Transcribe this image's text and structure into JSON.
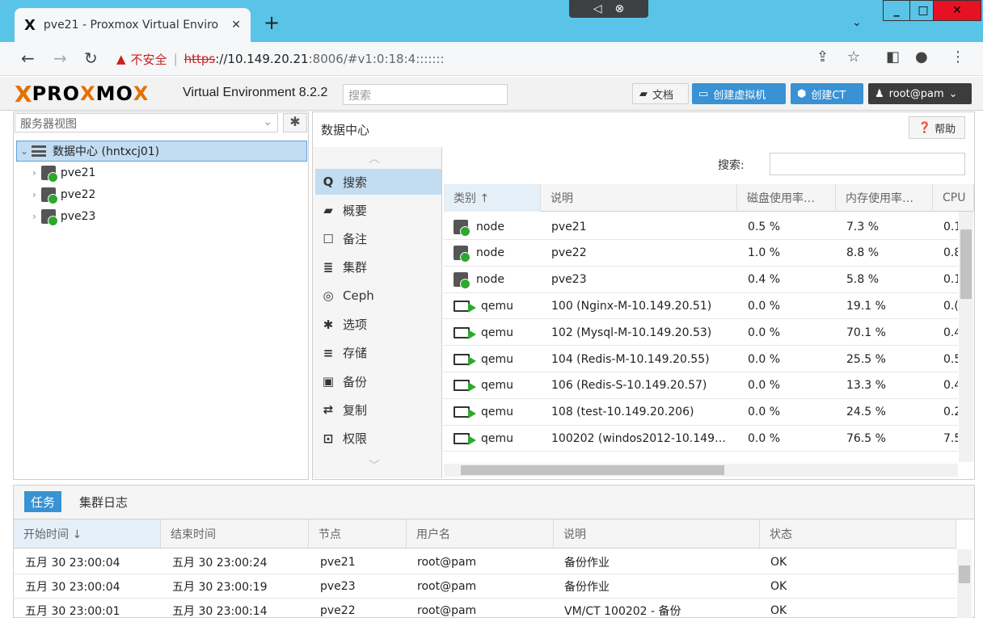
{
  "browser": {
    "tab_title": "pve21 - Proxmox Virtual Enviro",
    "tab_favicon": "X",
    "new_tab": "+",
    "url_warning": "不安全",
    "url_proto": "https",
    "url_host": "://10.149.20.21",
    "url_rest": ":8006/#v1:0:18:4:::::::"
  },
  "header": {
    "logo_x": "X",
    "logo_text_1": "PRO",
    "logo_text_x": "X",
    "logo_text_2": "MO",
    "logo_text_x2": "X",
    "app_name": "Virtual Environment 8.2.2",
    "search_placeholder": "搜索",
    "docs_label": "文档",
    "create_vm_label": "创建虚拟机",
    "create_ct_label": "创建CT",
    "user_label": "root@pam"
  },
  "tree": {
    "view_label": "服务器视图",
    "datacenter_label": "数据中心 (hntxcj01)",
    "nodes": [
      "pve21",
      "pve22",
      "pve23"
    ]
  },
  "center": {
    "title": "数据中心",
    "help_label": "帮助",
    "search_label": "搜索:",
    "menu": [
      {
        "icon": "search-icon",
        "glyph": "Q",
        "label": "搜索"
      },
      {
        "icon": "book-icon",
        "glyph": "▰",
        "label": "概要"
      },
      {
        "icon": "note-icon",
        "glyph": "☐",
        "label": "备注"
      },
      {
        "icon": "cluster-icon",
        "glyph": "≣",
        "label": "集群"
      },
      {
        "icon": "ceph-icon",
        "glyph": "◎",
        "label": "Ceph"
      },
      {
        "icon": "gear-icon",
        "glyph": "✱",
        "label": "选项"
      },
      {
        "icon": "storage-icon",
        "glyph": "≡",
        "label": "存储"
      },
      {
        "icon": "backup-icon",
        "glyph": "▣",
        "label": "备份"
      },
      {
        "icon": "replication-icon",
        "glyph": "⇄",
        "label": "复制"
      },
      {
        "icon": "unlock-icon",
        "glyph": "⊡",
        "label": "权限"
      }
    ],
    "columns": [
      "类别 ↑",
      "说明",
      "磁盘使用率…",
      "内存使用率…",
      "CPU"
    ],
    "rows": [
      {
        "type": "node",
        "desc": "pve21",
        "disk": "0.5 %",
        "mem": "7.3 %",
        "cpu": "0.1"
      },
      {
        "type": "node",
        "desc": "pve22",
        "disk": "1.0 %",
        "mem": "8.8 %",
        "cpu": "0.8"
      },
      {
        "type": "node",
        "desc": "pve23",
        "disk": "0.4 %",
        "mem": "5.8 %",
        "cpu": "0.1"
      },
      {
        "type": "qemu",
        "desc": "100 (Nginx-M-10.149.20.51)",
        "disk": "0.0 %",
        "mem": "19.1 %",
        "cpu": "0.("
      },
      {
        "type": "qemu",
        "desc": "102 (Mysql-M-10.149.20.53)",
        "disk": "0.0 %",
        "mem": "70.1 %",
        "cpu": "0.4"
      },
      {
        "type": "qemu",
        "desc": "104 (Redis-M-10.149.20.55)",
        "disk": "0.0 %",
        "mem": "25.5 %",
        "cpu": "0.5"
      },
      {
        "type": "qemu",
        "desc": "106 (Redis-S-10.149.20.57)",
        "disk": "0.0 %",
        "mem": "13.3 %",
        "cpu": "0.4"
      },
      {
        "type": "qemu",
        "desc": "108 (test-10.149.20.206)",
        "disk": "0.0 %",
        "mem": "24.5 %",
        "cpu": "0.2"
      },
      {
        "type": "qemu",
        "desc": "100202 (windos2012-10.149…",
        "disk": "0.0 %",
        "mem": "76.5 %",
        "cpu": "7.5"
      }
    ]
  },
  "tasks": {
    "tab_tasks": "任务",
    "tab_cluster_log": "集群日志",
    "columns": [
      "开始时间 ↓",
      "结束时间",
      "节点",
      "用户名",
      "说明",
      "状态"
    ],
    "rows": [
      {
        "start": "五月 30 23:00:04",
        "end": "五月 30 23:00:24",
        "node": "pve21",
        "user": "root@pam",
        "desc": "备份作业",
        "status": "OK"
      },
      {
        "start": "五月 30 23:00:04",
        "end": "五月 30 23:00:19",
        "node": "pve23",
        "user": "root@pam",
        "desc": "备份作业",
        "status": "OK"
      },
      {
        "start": "五月 30 23:00:01",
        "end": "五月 30 23:00:14",
        "node": "pve22",
        "user": "root@pam",
        "desc": "VM/CT 100202 - 备份",
        "status": "OK"
      }
    ]
  },
  "colors": {
    "accent": "#3892d4",
    "selected": "#c2ddf2",
    "proxmox_orange": "#e57000",
    "status_green": "#2da82d"
  }
}
